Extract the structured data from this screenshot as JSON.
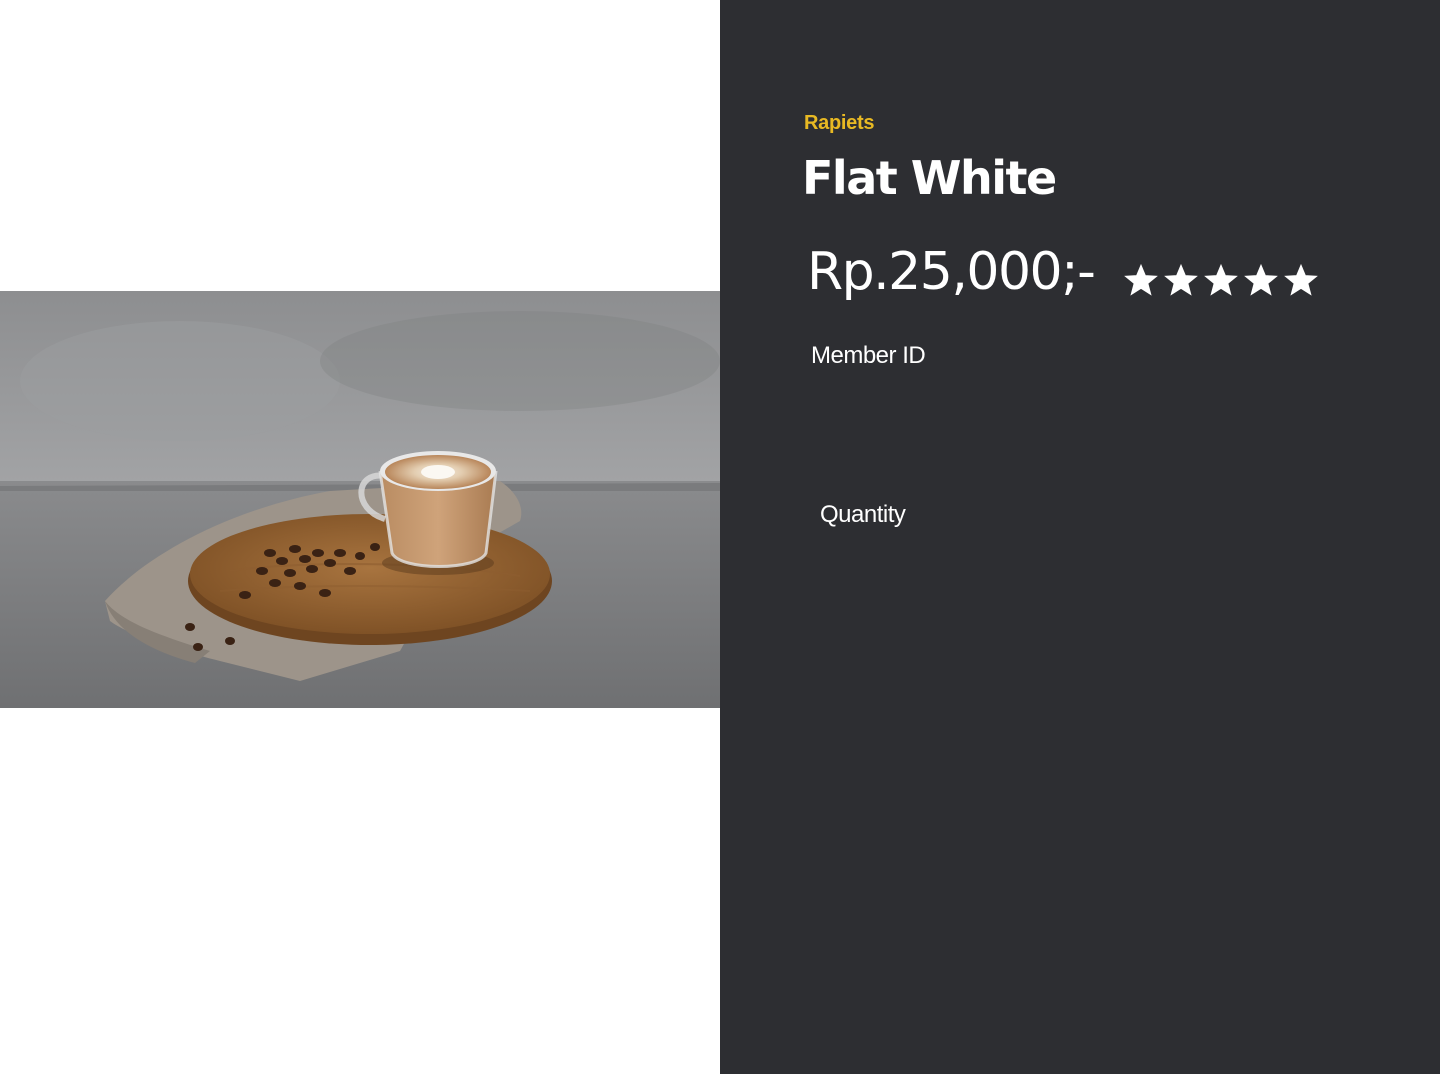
{
  "product": {
    "brand": "Rapiets",
    "name": "Flat White",
    "price": "Rp.25,000;-",
    "rating": {
      "value": 5,
      "max": 5,
      "icon": "star-icon"
    },
    "image": {
      "description_icon": "coffee-photo"
    }
  },
  "form": {
    "member_id_label": "Member ID",
    "quantity_label": "Quantity"
  },
  "colors": {
    "panel_bg": "#2d2e32",
    "brand_accent": "#e8b923",
    "text": "#ffffff"
  }
}
